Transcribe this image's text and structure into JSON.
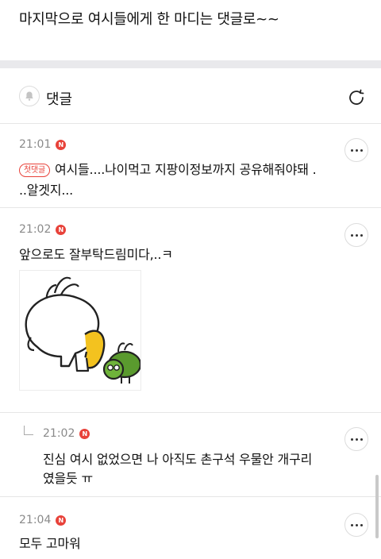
{
  "post": {
    "tail_text": "마지막으로 여시들에게 한 마디는 댓글로~~"
  },
  "comments_header": {
    "title": "댓글"
  },
  "comments": [
    {
      "time": "21:01",
      "badge": "N",
      "first_tag": "첫댓글",
      "text_line1": "여시들....나이먹고 지팡이정보까지 공유해줘야돼 .",
      "text_line2": "..알겟지..."
    },
    {
      "time": "21:02",
      "badge": "N",
      "text": "앞으로도 잘부탁드림미다,..ㅋ",
      "has_sticker": true
    },
    {
      "time": "21:02",
      "badge": "N",
      "is_reply": true,
      "text_line1": "진심 여시 없었으면 나 아직도 촌구석 우물안 개구리",
      "text_line2": "였을듯 ㅠ"
    },
    {
      "time": "21:04",
      "badge": "N",
      "text": "모두 고마워"
    }
  ]
}
